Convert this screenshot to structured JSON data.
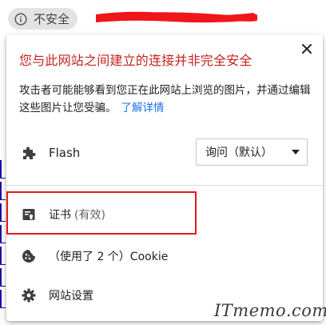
{
  "omnibox": {
    "security_label": "不安全",
    "icon": "info-icon"
  },
  "popup": {
    "warning_title": "您与此网站之间建立的连接并非完全安全",
    "warning_body": "攻击者可能能够看到您正在此网站上浏览的图片，并通过编辑这些图片让您受骗。",
    "learn_more": "了解详情",
    "close_icon": "close-icon",
    "permissions": [
      {
        "icon": "puzzle-icon",
        "label": "Flash",
        "select_value": "询问（默认）"
      }
    ],
    "certificate": {
      "icon": "certificate-icon",
      "label": "证书",
      "status": "(有效)"
    },
    "cookies": {
      "icon": "cookie-icon",
      "label": "（使用了 2 个）Cookie"
    },
    "site_settings": {
      "icon": "gear-icon",
      "label": "网站设置"
    }
  },
  "watermark": "ITmemo.com",
  "colors": {
    "warning_red": "#c5221f",
    "link_blue": "#1a73e8",
    "highlight_red": "#e3191a",
    "redaction_red": "#f0151b"
  }
}
